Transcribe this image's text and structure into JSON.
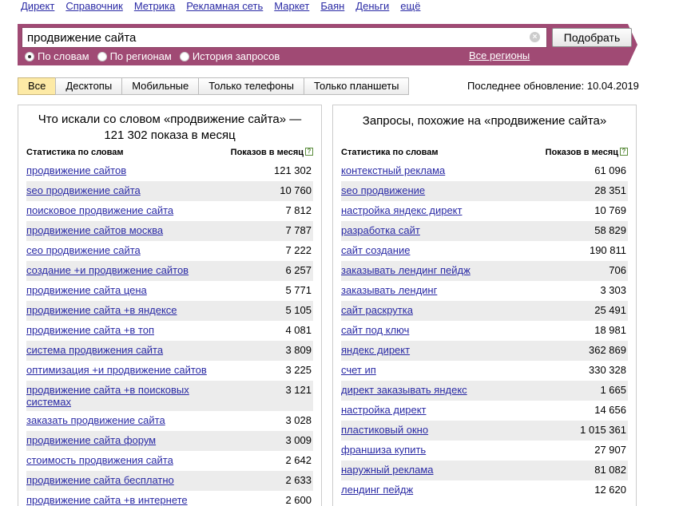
{
  "topnav": [
    "Директ",
    "Справочник",
    "Метрика",
    "Рекламная сеть",
    "Маркет",
    "Баян",
    "Деньги",
    "ещё"
  ],
  "search": {
    "value": "продвижение сайта",
    "submit_label": "Подобрать",
    "clear_glyph": "×",
    "modes": [
      {
        "label": "По словам",
        "selected": true
      },
      {
        "label": "По регионам",
        "selected": false
      },
      {
        "label": "История запросов",
        "selected": false
      }
    ],
    "regions_link": "Все регионы"
  },
  "device_tabs": [
    {
      "label": "Все",
      "active": true
    },
    {
      "label": "Десктопы",
      "active": false
    },
    {
      "label": "Мобильные",
      "active": false
    },
    {
      "label": "Только телефоны",
      "active": false
    },
    {
      "label": "Только планшеты",
      "active": false
    }
  ],
  "last_update": "Последнее обновление: 10.04.2019",
  "left_panel": {
    "title": "Что искали со словом «продвижение сайта» — 121 302 показа в месяц",
    "col_phrase": "Статистика по словам",
    "col_count": "Показов в месяц",
    "help_glyph": "?",
    "rows": [
      {
        "phrase": "продвижение сайтов",
        "count": "121 302"
      },
      {
        "phrase": "seo продвижение сайта",
        "count": "10 760"
      },
      {
        "phrase": "поисковое продвижение сайта",
        "count": "7 812"
      },
      {
        "phrase": "продвижение сайтов москва",
        "count": "7 787"
      },
      {
        "phrase": "сео продвижение сайта",
        "count": "7 222"
      },
      {
        "phrase": "создание +и продвижение сайтов",
        "count": "6 257"
      },
      {
        "phrase": "продвижение сайта цена",
        "count": "5 771"
      },
      {
        "phrase": "продвижение сайта +в яндексе",
        "count": "5 105"
      },
      {
        "phrase": "продвижение сайта +в топ",
        "count": "4 081"
      },
      {
        "phrase": "система продвижения сайта",
        "count": "3 809"
      },
      {
        "phrase": "оптимизация +и продвижение сайтов",
        "count": "3 225"
      },
      {
        "phrase": "продвижение сайта +в поисковых системах",
        "count": "3 121"
      },
      {
        "phrase": "заказать продвижение сайта",
        "count": "3 028"
      },
      {
        "phrase": "продвижение сайта форум",
        "count": "3 009"
      },
      {
        "phrase": "стоимость продвижения сайта",
        "count": "2 642"
      },
      {
        "phrase": "продвижение сайта бесплатно",
        "count": "2 633"
      },
      {
        "phrase": "продвижение сайта +в интернете",
        "count": "2 600"
      }
    ]
  },
  "right_panel": {
    "title": "Запросы, похожие на «продвижение сайта»",
    "col_phrase": "Статистика по словам",
    "col_count": "Показов в месяц",
    "help_glyph": "?",
    "rows": [
      {
        "phrase": "контекстный реклама",
        "count": "61 096"
      },
      {
        "phrase": "seo продвижение",
        "count": "28 351"
      },
      {
        "phrase": "настройка яндекс директ",
        "count": "10 769"
      },
      {
        "phrase": "разработка сайт",
        "count": "58 829"
      },
      {
        "phrase": "сайт создание",
        "count": "190 811"
      },
      {
        "phrase": "заказывать лендинг пейдж",
        "count": "706"
      },
      {
        "phrase": "заказывать лендинг",
        "count": "3 303"
      },
      {
        "phrase": "сайт раскрутка",
        "count": "25 491"
      },
      {
        "phrase": "сайт под ключ",
        "count": "18 981"
      },
      {
        "phrase": "яндекс директ",
        "count": "362 869"
      },
      {
        "phrase": "счет ип",
        "count": "330 328"
      },
      {
        "phrase": "директ заказывать яндекс",
        "count": "1 665"
      },
      {
        "phrase": "настройка директ",
        "count": "14 656"
      },
      {
        "phrase": "пластиковый окно",
        "count": "1 015 361"
      },
      {
        "phrase": "франшиза купить",
        "count": "27 907"
      },
      {
        "phrase": "наружный реклама",
        "count": "81 082"
      },
      {
        "phrase": "лендинг пейдж",
        "count": "12 620"
      }
    ]
  }
}
